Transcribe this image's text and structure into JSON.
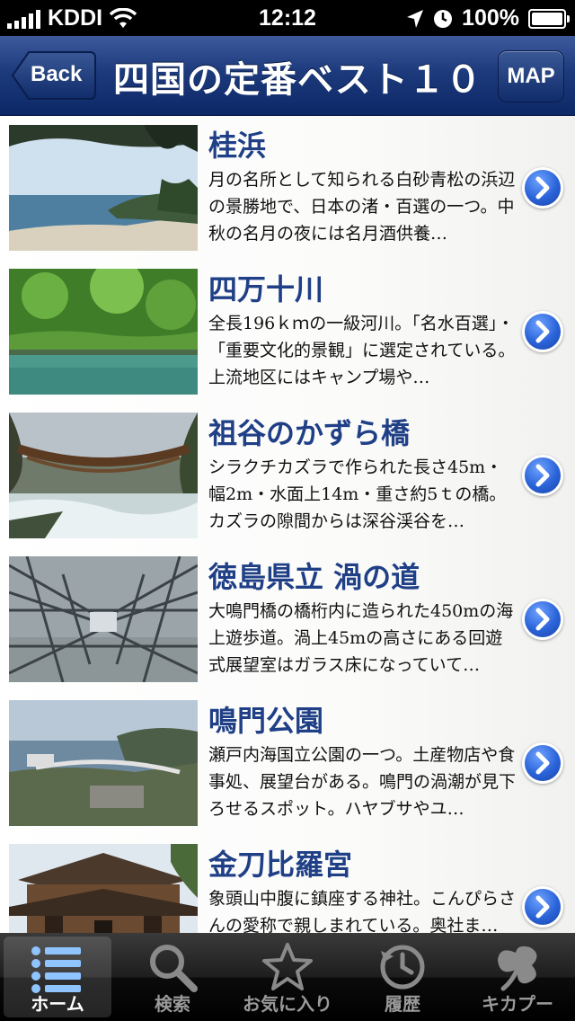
{
  "status_bar": {
    "carrier": "KDDI",
    "time": "12:12",
    "battery": "100%"
  },
  "nav": {
    "back_label": "Back",
    "title": "四国の定番ベスト１０",
    "map_label": "MAP"
  },
  "items": [
    {
      "title": "桂浜",
      "description": "月の名所として知られる白砂青松の浜辺の景勝地で、日本の渚・百選の一つ。中秋の名月の夜には名月酒供養…"
    },
    {
      "title": "四万十川",
      "description": "全長196ｋｍの一級河川。「名水百選」・「重要文化的景観」に選定されている。上流地区にはキャンプ場や…"
    },
    {
      "title": "祖谷のかずら橋",
      "description": "シラクチカズラで作られた長さ45m・幅2m・水面上14m・重さ約5ｔの橋。カズラの隙間からは深谷渓谷を…"
    },
    {
      "title": "徳島県立 渦の道",
      "description": "大鳴門橋の橋桁内に造られた450mの海上遊歩道。渦上45mの高さにある回遊式展望室はガラス床になっていて…"
    },
    {
      "title": "鳴門公園",
      "description": "瀬戸内海国立公園の一つ。土産物店や食事処、展望台がある。鳴門の渦潮が見下ろせるスポット。ハヤブサやユ…"
    },
    {
      "title": "金刀比羅宮",
      "description": "象頭山中腹に鎮座する神社。こんぴらさんの愛称で親しまれている。奥社ま…"
    }
  ],
  "tabs": [
    {
      "label": "ホーム",
      "icon": "list-icon"
    },
    {
      "label": "検索",
      "icon": "search-icon"
    },
    {
      "label": "お気に入り",
      "icon": "star-icon"
    },
    {
      "label": "履歴",
      "icon": "history-icon"
    },
    {
      "label": "キカプー",
      "icon": "kikapoo-logo-icon"
    }
  ],
  "colors": {
    "nav_bar": "#1d3a7c",
    "title_text": "#1f3f86",
    "disclosure": "#2a63d8"
  }
}
